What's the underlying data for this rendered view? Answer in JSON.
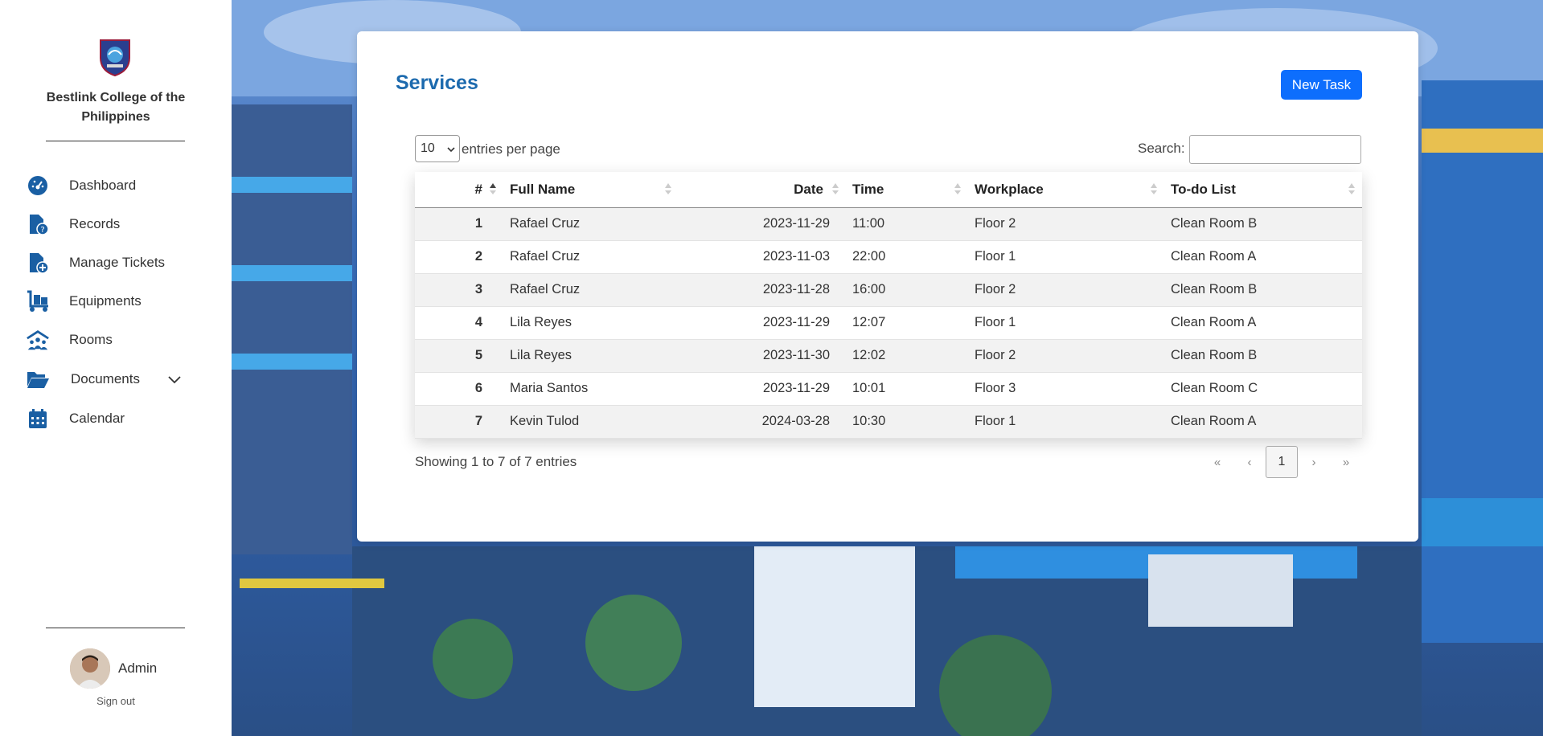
{
  "sidebar": {
    "org_name": "Bestlink College of the Philippines",
    "nav": [
      {
        "label": "Dashboard",
        "icon": "gauge-icon"
      },
      {
        "label": "Records",
        "icon": "file-question-icon"
      },
      {
        "label": "Manage Tickets",
        "icon": "file-plus-icon"
      },
      {
        "label": "Equipments",
        "icon": "dolly-icon"
      },
      {
        "label": "Rooms",
        "icon": "people-roof-icon"
      },
      {
        "label": "Documents",
        "icon": "folder-open-icon"
      },
      {
        "label": "Calendar",
        "icon": "calendar-icon"
      }
    ],
    "user_name": "Admin",
    "sign_out": "Sign out"
  },
  "colors": {
    "accent": "#1c6aae",
    "primary_button": "#0d6efd",
    "icon": "#1a5fa3"
  },
  "card": {
    "title": "Services",
    "new_task_label": "New Task",
    "length_value": "10",
    "length_label": "entries per page",
    "search_label": "Search:",
    "search_value": "",
    "table": {
      "headers": [
        "#",
        "Full Name",
        "Date",
        "Time",
        "Workplace",
        "To-do List"
      ],
      "rows": [
        [
          "1",
          "Rafael Cruz",
          "2023-11-29",
          "11:00",
          "Floor 2",
          "Clean Room B"
        ],
        [
          "2",
          "Rafael Cruz",
          "2023-11-03",
          "22:00",
          "Floor 1",
          "Clean Room A"
        ],
        [
          "3",
          "Rafael Cruz",
          "2023-11-28",
          "16:00",
          "Floor 2",
          "Clean Room B"
        ],
        [
          "4",
          "Lila Reyes",
          "2023-11-29",
          "12:07",
          "Floor 1",
          "Clean Room A"
        ],
        [
          "5",
          "Lila Reyes",
          "2023-11-30",
          "12:02",
          "Floor 2",
          "Clean Room B"
        ],
        [
          "6",
          "Maria Santos",
          "2023-11-29",
          "10:01",
          "Floor 3",
          "Clean Room C"
        ],
        [
          "7",
          "Kevin Tulod",
          "2024-03-28",
          "10:30",
          "Floor 1",
          "Clean Room A"
        ]
      ]
    },
    "info": "Showing 1 to 7 of 7 entries",
    "pager": {
      "first": "«",
      "prev": "‹",
      "current": "1",
      "next": "›",
      "last": "»"
    }
  }
}
